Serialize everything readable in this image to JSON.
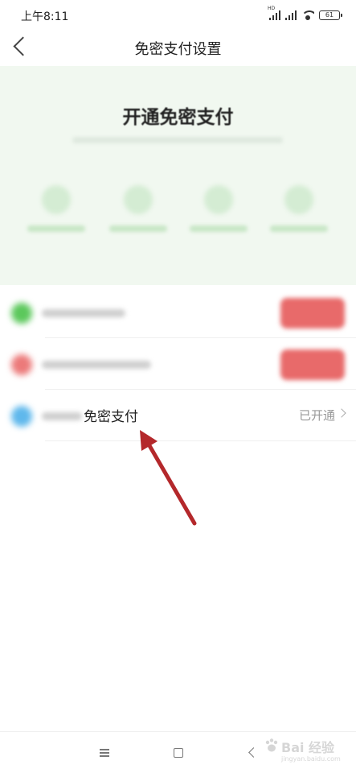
{
  "status_bar": {
    "time": "上午8:11",
    "battery": "61"
  },
  "nav": {
    "title": "免密支付设置"
  },
  "hero": {
    "title": "开通免密支付"
  },
  "rows": [
    {
      "icon": "green-circle-icon",
      "icon_color": "#5cc85c"
    },
    {
      "icon": "red-circle-icon",
      "icon_color": "#ec7a7a"
    },
    {
      "icon": "blue-circle-icon",
      "icon_color": "#5fb8ec",
      "label": "免密支付",
      "status": "已开通"
    }
  ],
  "colors": {
    "hero_bg": "#f1f8f0",
    "action_red": "#e86a6a",
    "arrow": "#b4282b"
  },
  "watermark": {
    "text": "Bai 经验",
    "url": "jingyan.baidu.com"
  }
}
